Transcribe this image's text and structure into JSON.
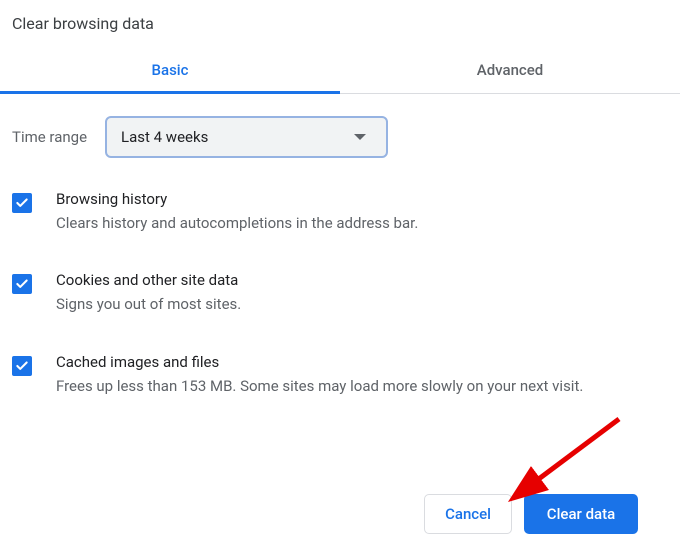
{
  "title": "Clear browsing data",
  "tabs": {
    "basic": "Basic",
    "advanced": "Advanced"
  },
  "time_range": {
    "label": "Time range",
    "value": "Last 4 weeks"
  },
  "items": [
    {
      "title": "Browsing history",
      "desc": "Clears history and autocompletions in the address bar."
    },
    {
      "title": "Cookies and other site data",
      "desc": "Signs you out of most sites."
    },
    {
      "title": "Cached images and files",
      "desc": "Frees up less than 153 MB. Some sites may load more slowly on your next visit."
    }
  ],
  "buttons": {
    "cancel": "Cancel",
    "clear": "Clear data"
  },
  "colors": {
    "accent": "#1a73e8"
  }
}
